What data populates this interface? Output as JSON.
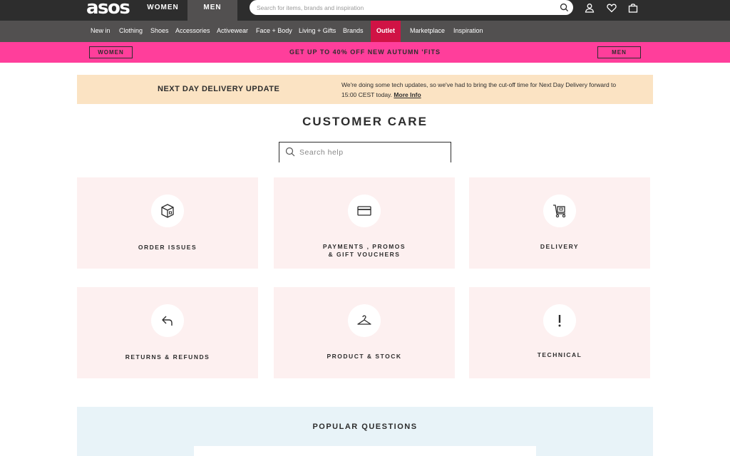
{
  "header": {
    "logo": "asos",
    "gender_tabs": [
      "WOMEN",
      "MEN"
    ],
    "search_placeholder": "Search for items, brands and inspiration",
    "icons": [
      "search-icon",
      "account-icon",
      "heart-icon",
      "bag-icon"
    ]
  },
  "nav": {
    "items": [
      "New in",
      "Clothing",
      "Shoes",
      "Accessories",
      "Activewear",
      "Face + Body",
      "Living + Gifts",
      "Brands",
      "Outlet",
      "Marketplace",
      "Inspiration"
    ]
  },
  "promo": {
    "left_button": "WOMEN",
    "text": "GET UP TO 40% OFF NEW AUTUMN 'FITS",
    "right_button": "MEN"
  },
  "banner": {
    "title": "NEXT DAY DELIVERY UPDATE",
    "text": "We're doing some tech updates, so we've had to bring the cut-off time for Next Day Delivery forward to 15:00 CEST today.",
    "link": "More Info"
  },
  "main": {
    "title": "CUSTOMER CARE",
    "search_placeholder": "Search help"
  },
  "cards": [
    {
      "label_1": "ORDER ISSUES",
      "label_2": "",
      "icon": "box-icon"
    },
    {
      "label_1": "PAYMENTS , PROMOS",
      "label_2": "& GIFT VOUCHERS",
      "icon": "card-icon"
    },
    {
      "label_1": "DELIVERY",
      "label_2": "",
      "icon": "trolley-icon"
    },
    {
      "label_1": "RETURNS & REFUNDS",
      "label_2": "",
      "icon": "return-arrow-icon"
    },
    {
      "label_1": "PRODUCT & STOCK",
      "label_2": "",
      "icon": "hanger-icon"
    },
    {
      "label_1": "TECHNICAL",
      "label_2": "",
      "icon": "exclamation-icon"
    }
  ],
  "popular": {
    "title": "POPULAR QUESTIONS"
  },
  "colors": {
    "topbar": "#2d2d2d",
    "navbar": "#525050",
    "outlet": "#d01345",
    "promo": "#ff3e9b",
    "banner": "#fbe3c3",
    "card": "#fdf0f0",
    "popular": "#e8f3f8"
  }
}
